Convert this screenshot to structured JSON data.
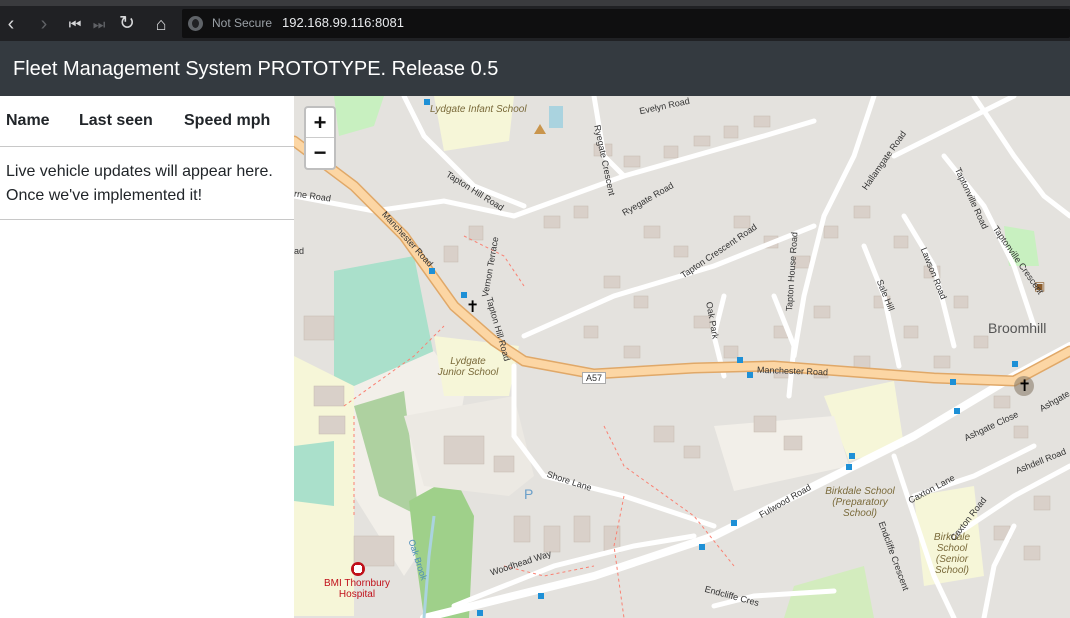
{
  "browser": {
    "security_label": "Not Secure",
    "url": "192.168.99.116:8081",
    "icons": [
      "back-icon",
      "forward-icon",
      "first-icon",
      "last-icon",
      "reload-icon",
      "home-icon",
      "globe-icon"
    ]
  },
  "app": {
    "title": "Fleet Management System PROTOTYPE. Release 0.5"
  },
  "vehicle_table": {
    "columns": [
      "Name",
      "Last seen",
      "Speed mph"
    ],
    "placeholder_line1": "Live vehicle updates will appear here.",
    "placeholder_line2": "Once we've implemented it!"
  },
  "map": {
    "zoom_in": "+",
    "zoom_out": "−",
    "labels": {
      "lydgate_infant": "Lydgate Infant School",
      "lydgate_junior": "Lydgate Junior School",
      "birkdale_prep": "Birkdale School (Preparatory School)",
      "birkdale_senior": "Birkdale School (Senior School)",
      "hospital": "BMI Thornbury Hospital",
      "broomhill": "Broomhill",
      "manchester_road_1": "Manchester Road",
      "manchester_road_2": "Manchester Road",
      "a57": "A57",
      "evelyn_road": "Evelyn Road",
      "ryegate_crescent": "Ryegate Crescent",
      "ryegate_road": "Ryegate Road",
      "tapton_hill_road_1": "Tapton Hill Road",
      "tapton_hill_road_2": "Tapton Hill Road",
      "vernon_terrace": "Vernon Terrace",
      "tapton_crescent_road": "Tapton Crescent Road",
      "tapton_house_road": "Tapton House Road",
      "oak_park": "Oak Park",
      "sale_hill": "Sale Hill",
      "lawson_road": "Lawson Road",
      "hallamgate_road": "Hallamgate Road",
      "taptonville_road": "Taptonville Road",
      "taptonville_crescent": "Taptonville Crescent",
      "ashgate_close": "Ashgate Close",
      "ashdell_road": "Ashdell Road",
      "caxton_lane": "Caxton Lane",
      "caxton_road": "Caxton Road",
      "fulwood_road": "Fulwood Road",
      "endcliffe_crescent": "Endcliffe Crescent",
      "shore_lane": "Shore Lane",
      "woodhead_way": "Woodhead Way",
      "oak_brook": "Oak Brook",
      "parking": "P",
      "road_fragment_left": "rne Road",
      "road_fragment_ad": "ad",
      "endcliffe_fragment": "Endcliffe Cres",
      "ashgate_fragment": "Ashgate"
    }
  }
}
